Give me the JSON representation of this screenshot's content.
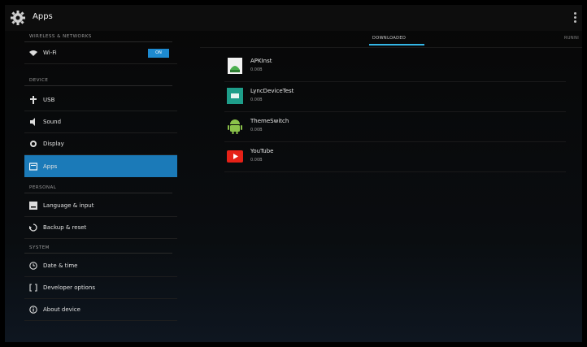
{
  "actionbar": {
    "title": "Apps"
  },
  "sidebar": {
    "headers": {
      "wireless": "WIRELESS & NETWORKS",
      "device": "DEVICE",
      "personal": "PERSONAL",
      "system": "SYSTEM"
    },
    "items": [
      {
        "label": "Wi-Fi",
        "toggle": "ON"
      },
      {
        "label": "USB"
      },
      {
        "label": "Sound"
      },
      {
        "label": "Display"
      },
      {
        "label": "Apps"
      },
      {
        "label": "Language & input"
      },
      {
        "label": "Backup & reset"
      },
      {
        "label": "Date & time"
      },
      {
        "label": "Developer options"
      },
      {
        "label": "About device"
      }
    ],
    "active": "Apps"
  },
  "tabs": [
    {
      "label": "DOWNLOADED",
      "selected": true
    },
    {
      "label": "RUNNI"
    }
  ],
  "apps": [
    {
      "name": "APKInst",
      "size": "0.00B"
    },
    {
      "name": "LyncDeviceTest",
      "size": "0.00B"
    },
    {
      "name": "ThemeSwitch",
      "size": "0.00B"
    },
    {
      "name": "YouTube",
      "size": "0.00B"
    }
  ],
  "colors": {
    "accent": "#1b7ab8",
    "tab_indicator": "#33b5e5"
  }
}
